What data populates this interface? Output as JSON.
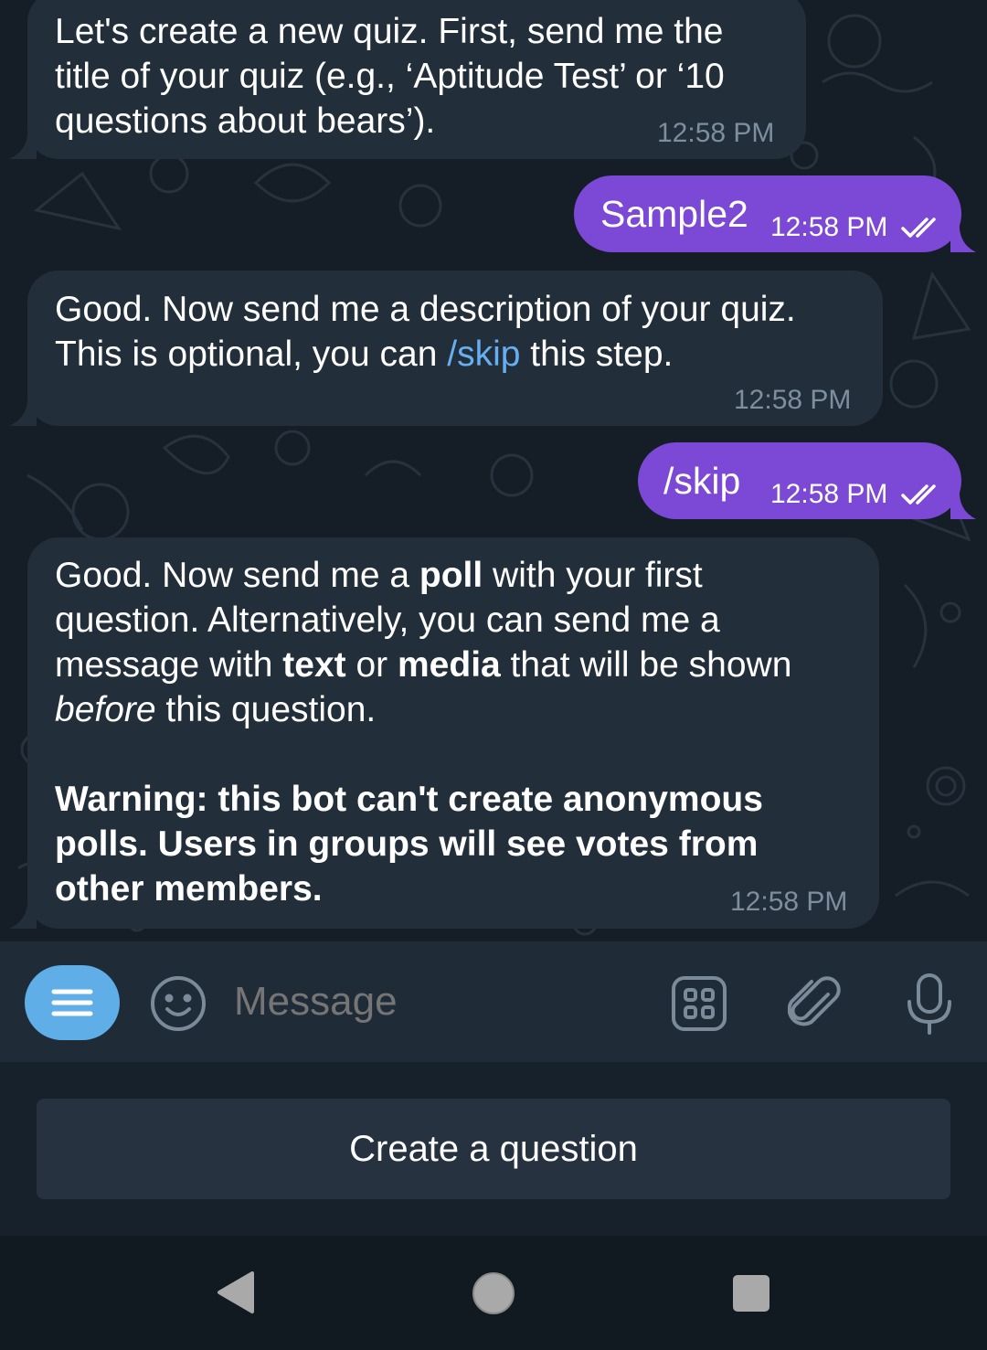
{
  "messages": [
    {
      "direction": "incoming",
      "lines": [
        "Let's create a new quiz. First, send me the",
        "title of your quiz (e.g., ‘Aptitude Test’ or ‘10",
        "questions about bears’)."
      ],
      "time": "12:58 PM"
    },
    {
      "direction": "outgoing",
      "text": "Sample2",
      "time": "12:58 PM",
      "status": "read"
    },
    {
      "direction": "incoming",
      "line1": "Good. Now send me a description of your quiz.",
      "line2_before": "This is optional, you can ",
      "line2_link": "/skip",
      "line2_after": " this step.",
      "time": "12:58 PM"
    },
    {
      "direction": "outgoing",
      "text": "/skip",
      "time": "12:58 PM",
      "status": "read"
    },
    {
      "direction": "incoming",
      "p1": {
        "a": "Good. Now send me a ",
        "b_poll": "poll",
        "c": " with your first",
        "d": "question. Alternatively, you can send me a",
        "e": "message with ",
        "f_text": "text",
        "g": " or ",
        "h_media": "media",
        "i": " that will be shown",
        "j_before": "before",
        "k": " this question."
      },
      "warning_lines": [
        "Warning: this bot can't create anonymous",
        "polls. Users in groups will see votes from",
        "other members."
      ],
      "time": "12:58 PM"
    }
  ],
  "composer": {
    "placeholder": "Message",
    "icons": [
      "menu-icon",
      "emoji-icon",
      "bot-keyboard-icon",
      "attach-icon",
      "microphone-icon"
    ]
  },
  "keyboard": {
    "button_label": "Create a question"
  },
  "navbar": {
    "icons": [
      "back-icon",
      "home-icon",
      "recents-icon"
    ]
  },
  "colors": {
    "chat_bg": "#151e27",
    "incoming_bubble": "#222e3a",
    "outgoing_bubble": "#7b49d5",
    "link": "#66aff0",
    "accent_button": "#5faee8"
  }
}
